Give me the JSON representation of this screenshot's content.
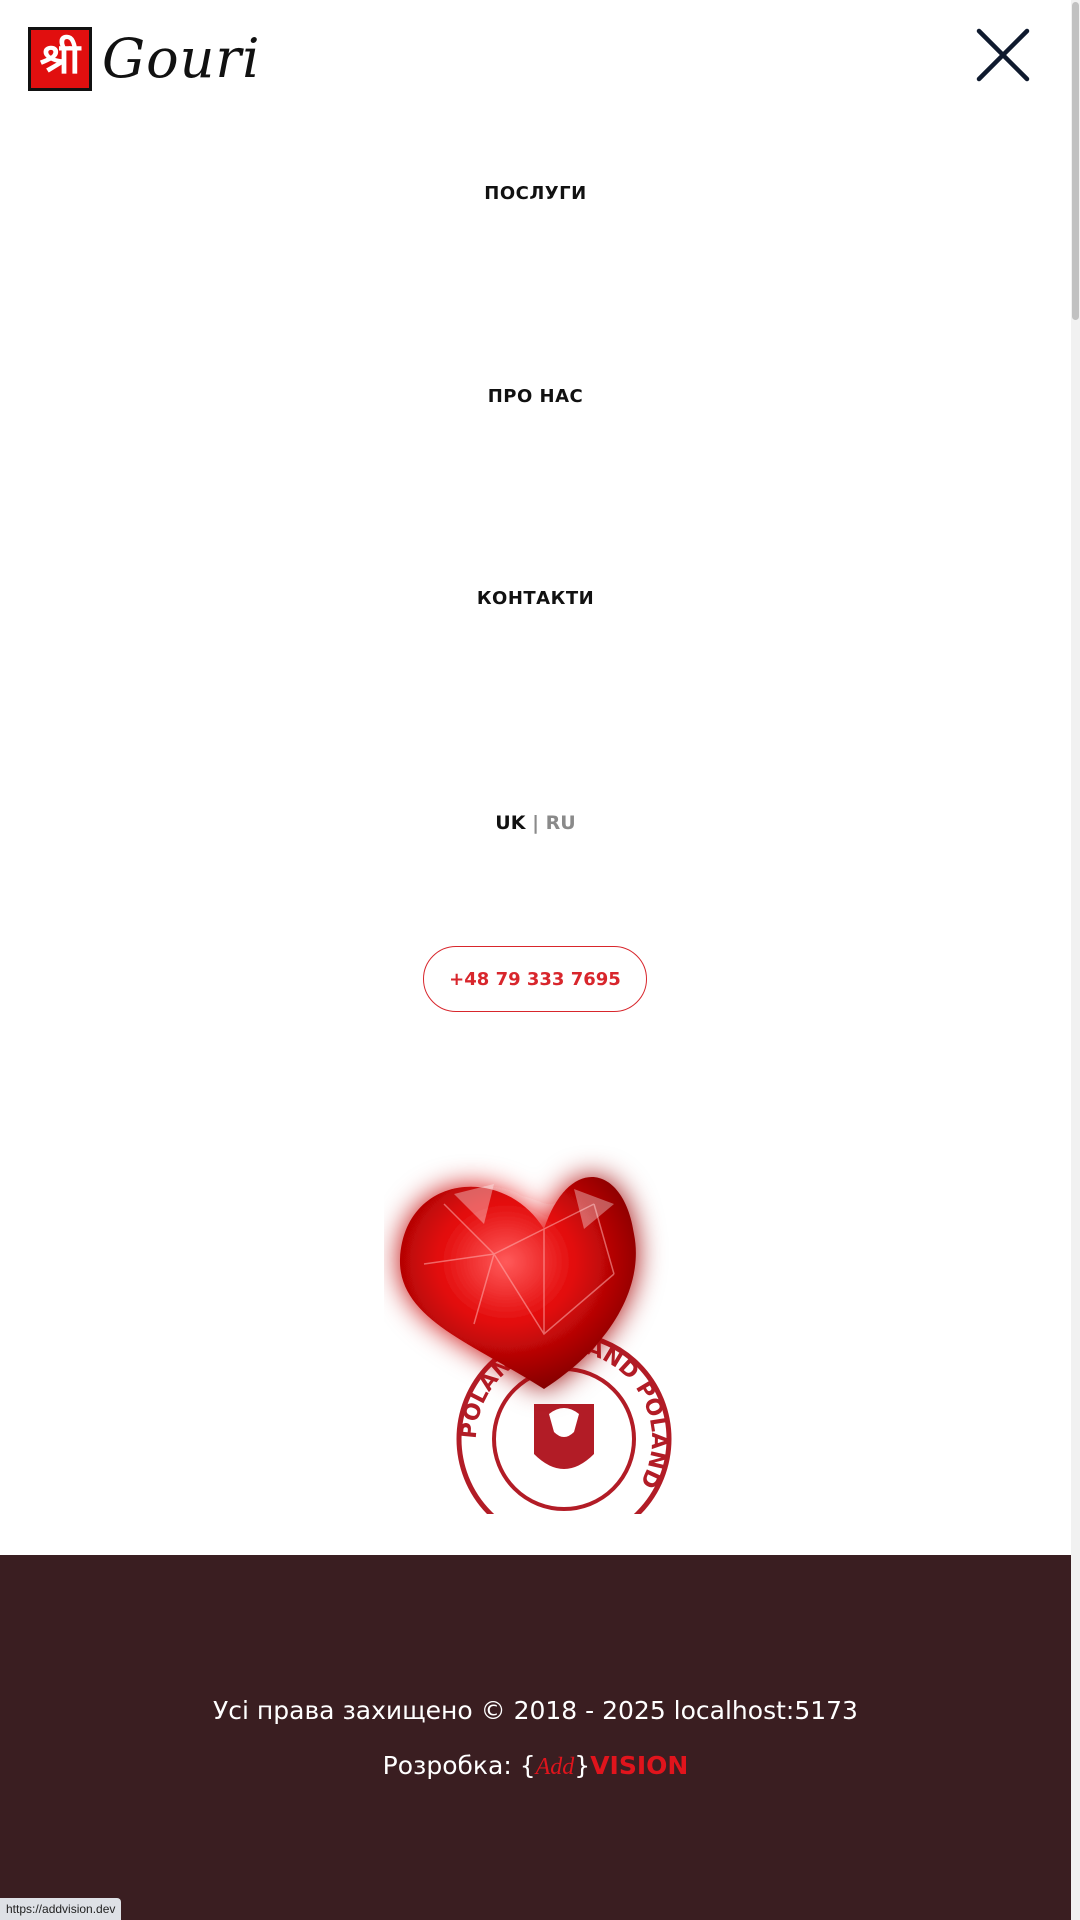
{
  "header": {
    "logo_mark": "श्री",
    "logo_word": "Gouri",
    "close_icon": "close-icon"
  },
  "nav": {
    "items": [
      {
        "label": "ПОСЛУГИ"
      },
      {
        "label": "ПРО НАС"
      },
      {
        "label": "КОНТАКТИ"
      }
    ]
  },
  "language": {
    "active": "UK",
    "separator": "|",
    "inactive": "RU"
  },
  "contact": {
    "phone": "+48 79 333 7695"
  },
  "image": {
    "stamp_text": "POLAND POLAND POLAND"
  },
  "footer": {
    "copyright": "Усі права захищено © 2018 - 2025 localhost:5173",
    "dev_prefix": "Розробка: ",
    "brand_open": "{",
    "brand_add": "Add",
    "brand_close": "}",
    "brand_vision": "VISION"
  },
  "status_bar": {
    "url": "https://addvision.dev"
  },
  "colors": {
    "accent": "#e0141c",
    "footer_bg": "#3a1e21"
  }
}
